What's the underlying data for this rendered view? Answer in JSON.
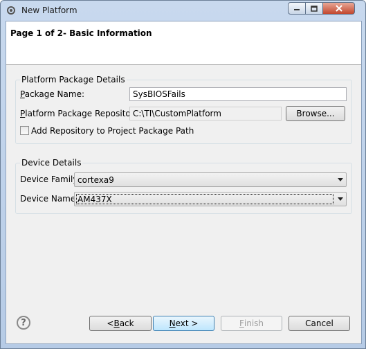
{
  "window": {
    "title": "New Platform"
  },
  "header": {
    "title": "Page 1 of 2- Basic Information"
  },
  "platform_details": {
    "legend": "Platform Package Details",
    "package_name_label": "Package Name:",
    "package_name_value": "SysBIOSFails",
    "repository_label": "Platform Package Repository:",
    "repository_value": "C:\\TI\\CustomPlatform",
    "browse_label": "Browse...",
    "add_repo_label": "Add Repository to Project Package Path",
    "add_repo_checked": false
  },
  "device_details": {
    "legend": "Device Details",
    "family_label": "Device Family",
    "family_value": "cortexa9",
    "name_label": "Device Name",
    "name_value": "AM437X"
  },
  "footer": {
    "back_label": "< Back",
    "next_label": "Next >",
    "finish_label": "Finish",
    "cancel_label": "Cancel"
  },
  "icons": [
    "app-icon",
    "minimize-icon",
    "maximize-icon",
    "close-icon",
    "help-icon",
    "chevron-down-icon"
  ]
}
